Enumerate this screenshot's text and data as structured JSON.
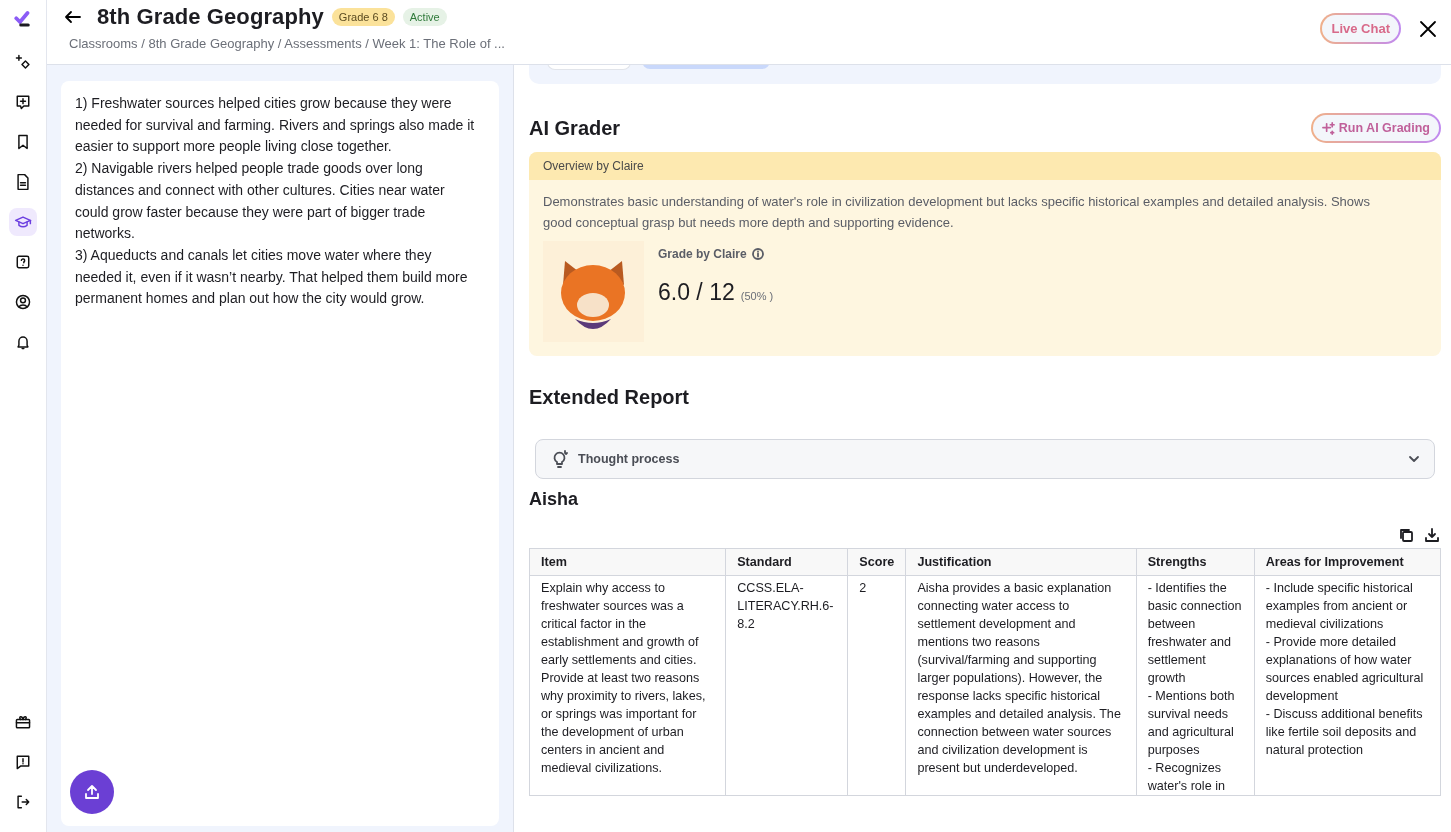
{
  "sidebar": {
    "top_items": [
      {
        "selected": false
      },
      {
        "selected": false
      },
      {
        "selected": false
      },
      {
        "selected": false
      },
      {
        "selected": true
      },
      {
        "selected": false
      },
      {
        "selected": false
      },
      {
        "selected": false
      }
    ],
    "bottom_items": [
      {
        "selected": false
      },
      {
        "selected": false
      },
      {
        "selected": false
      }
    ]
  },
  "header": {
    "title": "8th Grade Geography",
    "badges": [
      {
        "label": "Grade 6 8",
        "color": "#fbe29a"
      },
      {
        "label": "Active",
        "color": "#e6f2e6"
      }
    ],
    "breadcrumb": "Classrooms / 8th Grade Geography / Assessments / Week 1: The Role of ...",
    "live_chat": "Live Chat"
  },
  "submission": {
    "paragraphs": [
      "1) Freshwater sources helped cities grow because they were needed for survival and farming. Rivers and springs also made it easier to support more people living close together.",
      "2) Navigable rivers helped people trade goods over long distances and connect with other cultures. Cities near water could grow faster because they were part of bigger trade networks.",
      "3) Aqueducts and canals let cities move water where they needed it, even if it wasn’t nearby. That helped them build more permanent homes and plan out how the city would grow."
    ]
  },
  "ai_grader": {
    "title": "AI Grader",
    "run_button": "Run AI Grading",
    "overview_label": "Overview by Claire",
    "overview_text": "Demonstrates basic understanding of water's role in civilization development but lacks specific historical examples and detailed analysis. Shows good conceptual grasp but needs more depth and supporting evidence.",
    "grade_label": "Grade by Claire",
    "score": "6.0 / 12",
    "percent": "(50% )"
  },
  "report": {
    "title": "Extended Report",
    "thought_process": "Thought process",
    "expanded": false,
    "student": "Aisha",
    "table": {
      "columns": [
        "Item",
        "Standard",
        "Score",
        "Justification",
        "Strengths",
        "Areas for Improvement"
      ],
      "rows": [
        [
          "Explain why access to freshwater sources was a critical factor in the establishment and growth of early settlements and cities. Provide at least two reasons why proximity to rivers, lakes, or springs was important for the development of urban centers in ancient and medieval civilizations.",
          "CCSS.ELA-LITERACY.RH.6-8.2",
          "2",
          "Aisha provides a basic explanation connecting water access to settlement development and mentions two reasons (survival/farming and supporting larger populations). However, the response lacks specific historical examples and detailed analysis. The connection between water sources and civilization development is present but underdeveloped.",
          "- Identifies the basic connection between freshwater and settlement growth\n- Mentions both survival needs and agricultural purposes\n- Recognizes water's role in",
          "- Include specific historical examples from ancient or medieval civilizations\n- Provide more detailed explanations of how water sources enabled agricultural development\n- Discuss additional benefits like fertile soil deposits and natural protection"
        ]
      ]
    }
  }
}
